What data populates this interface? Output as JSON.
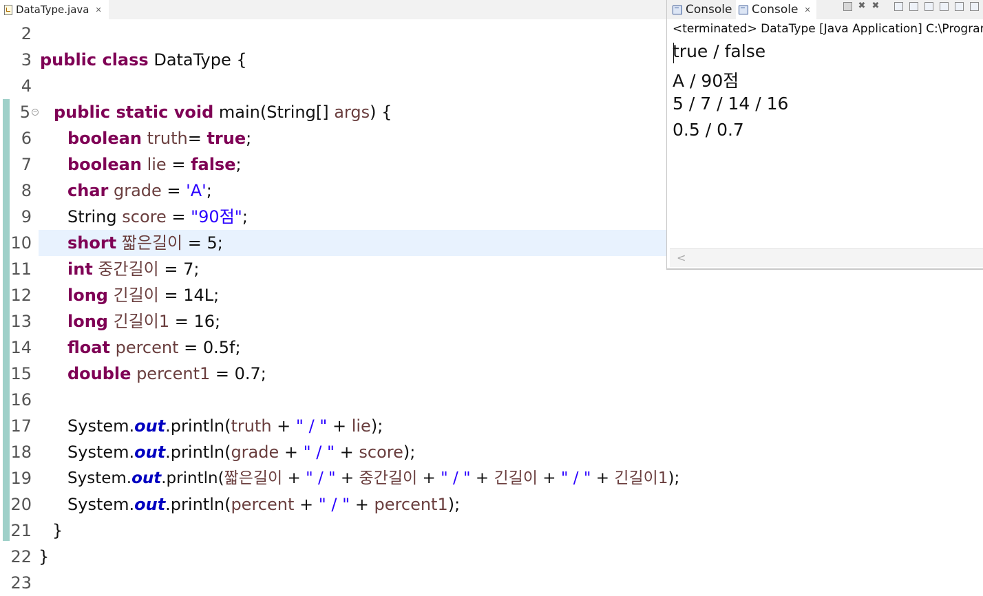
{
  "editor_tab": {
    "title": "DataType.java",
    "close": "✕"
  },
  "lines": [
    {
      "n": "2"
    },
    {
      "n": "3"
    },
    {
      "n": "4"
    },
    {
      "n": "5"
    },
    {
      "n": "6"
    },
    {
      "n": "7"
    },
    {
      "n": "8"
    },
    {
      "n": "9"
    },
    {
      "n": "10"
    },
    {
      "n": "11"
    },
    {
      "n": "12"
    },
    {
      "n": "13"
    },
    {
      "n": "14"
    },
    {
      "n": "15"
    },
    {
      "n": "16"
    },
    {
      "n": "17"
    },
    {
      "n": "18"
    },
    {
      "n": "19"
    },
    {
      "n": "20"
    },
    {
      "n": "21"
    },
    {
      "n": "22"
    },
    {
      "n": "23"
    }
  ],
  "code": {
    "l3": {
      "kw": "public class",
      "rest": " DataType {"
    },
    "l5": {
      "kw": "public static void",
      "rest": " main(String[] ",
      "var": "args",
      "tail": ") {"
    },
    "l6": {
      "kw": "boolean",
      "var": " truth",
      "mid": "= ",
      "kw2": "true",
      "tail": ";"
    },
    "l7": {
      "kw": "boolean",
      "var": " lie",
      "mid": " = ",
      "kw2": "false",
      "tail": ";"
    },
    "l8": {
      "kw": "char",
      "var": " grade",
      "mid": " = ",
      "str": "'A'",
      "tail": ";"
    },
    "l9": {
      "pre": "String",
      "var": " score",
      "mid": " = ",
      "str": "\"90점\"",
      "tail": ";"
    },
    "l10": {
      "kw": "short",
      "var": " 짧은길이",
      "tail": " = 5;"
    },
    "l11": {
      "kw": "int",
      "var": " 중간길이",
      "tail": " = 7;"
    },
    "l12": {
      "kw": "long",
      "var": " 긴길이",
      "tail": " = 14L;"
    },
    "l13": {
      "kw": "long",
      "var": " 긴길이1",
      "tail": " = 16;"
    },
    "l14": {
      "kw": "float",
      "var": " percent",
      "tail": " = 0.5f;"
    },
    "l15": {
      "kw": "double",
      "var": " percent1",
      "tail": " = 0.7;"
    },
    "l17": {
      "a": "System.",
      "fld": "out",
      "b": ".println(",
      "v1": "truth",
      "c": " + ",
      "s1": "\" / \"",
      "d": " + ",
      "v2": "lie",
      "e": ");"
    },
    "l18": {
      "a": "System.",
      "fld": "out",
      "b": ".println(",
      "v1": "grade",
      "c": " + ",
      "s1": "\" / \"",
      "d": " + ",
      "v2": "score",
      "e": ");"
    },
    "l19": {
      "a": "System.",
      "fld": "out",
      "b": ".println(",
      "v1": "짧은길이",
      "c": " + ",
      "s1": "\" / \"",
      "d": " + ",
      "v2": "중간길이",
      "f": " + ",
      "s2": "\" / \"",
      "g": " + ",
      "v3": "긴길이",
      "h": " + ",
      "s3": "\" / \"",
      "i": " + ",
      "v4": "긴길이1",
      "e": ");"
    },
    "l20": {
      "a": "System.",
      "fld": "out",
      "b": ".println(",
      "v1": "percent",
      "c": " + ",
      "s1": "\" / \"",
      "d": " + ",
      "v2": "percent1",
      "e": ");"
    },
    "l21": {
      "text": "}"
    },
    "l22": {
      "text": "}"
    }
  },
  "console": {
    "tab1": "Console",
    "tab2": "Console",
    "tab_close": "✕",
    "status": "<terminated> DataType [Java Application] C:\\Program",
    "output": [
      "true / false",
      "A / 90점",
      "5 / 7 / 14 / 16",
      "0.5 / 0.7"
    ],
    "scroll_left": "<"
  }
}
